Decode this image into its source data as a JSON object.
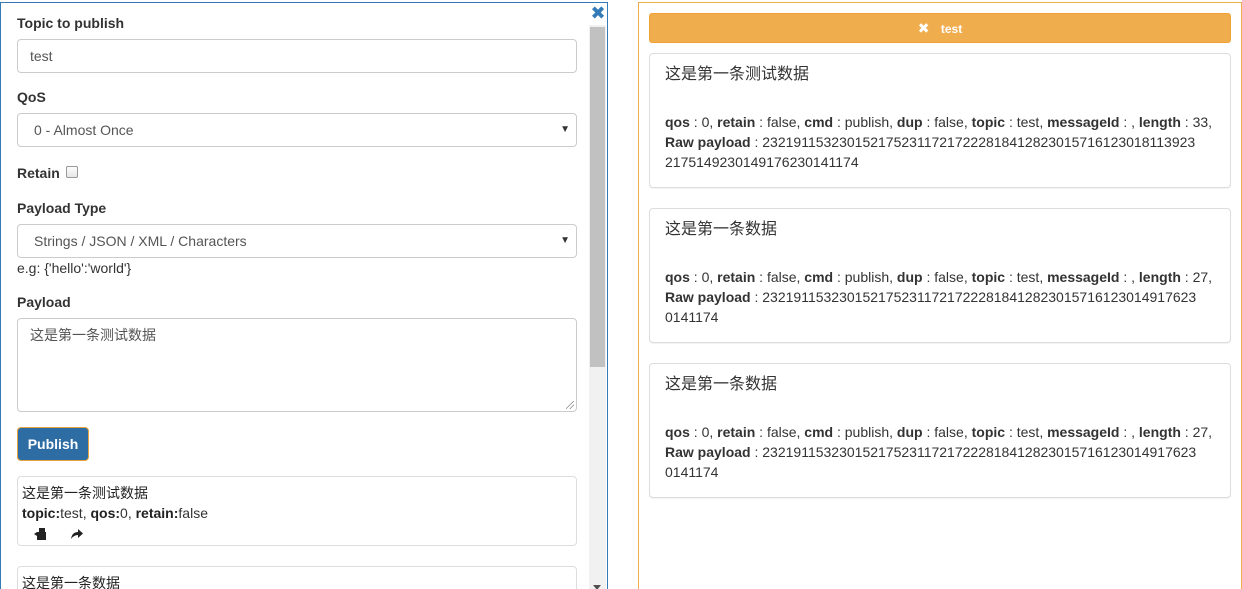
{
  "publish_form": {
    "topic_label": "Topic to publish",
    "topic_value": "test",
    "qos_label": "QoS",
    "qos_value": "0 - Almost Once",
    "retain_label": "Retain",
    "retain_checked": false,
    "payload_type_label": "Payload Type",
    "payload_type_value": "Strings / JSON / XML / Characters",
    "payload_hint": "e.g: {'hello':'world'}",
    "payload_label": "Payload",
    "payload_value": "这是第一条测试数据",
    "publish_button": "Publish",
    "close_icon": "close-icon"
  },
  "published_messages": [
    {
      "payload": "这是第一条测试数据",
      "topic_key": "topic:",
      "topic_value": "test",
      "qos_key": "qos:",
      "qos_value": "0",
      "retain_key": "retain:",
      "retain_value": "false",
      "actions": [
        "copy-icon",
        "forward-icon"
      ]
    },
    {
      "payload": "这是第一条数据"
    }
  ],
  "subscription": {
    "tab_label": "test",
    "tab_icon": "close-icon",
    "accent_color": "#f0ad4e",
    "messages": [
      {
        "payload": "这是第一条测试数据",
        "qos": "0",
        "retain": "false",
        "cmd": "publish",
        "dup": "false",
        "topic": "test",
        "messageId": "",
        "length": "33,",
        "raw_payload_line1": "23219115323015217523117217222818412823015716123018113923",
        "raw_payload_line2": "2175149230149176230141174"
      },
      {
        "payload": "这是第一条数据",
        "qos": "0",
        "retain": "false",
        "cmd": "publish",
        "dup": "false",
        "topic": "test",
        "messageId": "",
        "length": "27,",
        "raw_payload_line1": "23219115323015217523117217222818412823015716123014917623",
        "raw_payload_line2": "0141174"
      },
      {
        "payload": "这是第一条数据",
        "qos": "0",
        "retain": "false",
        "cmd": "publish",
        "dup": "false",
        "topic": "test",
        "messageId": "",
        "length": "27,",
        "raw_payload_line1": "23219115323015217523117217222818412823015716123014917623",
        "raw_payload_line2": "0141174"
      }
    ]
  },
  "meta_labels": {
    "qos": "qos",
    "retain": "retain",
    "cmd": "cmd",
    "dup": "dup",
    "topic": "topic",
    "messageId": "messageId",
    "length": "length",
    "raw_payload": "Raw payload",
    "sep": " : "
  }
}
